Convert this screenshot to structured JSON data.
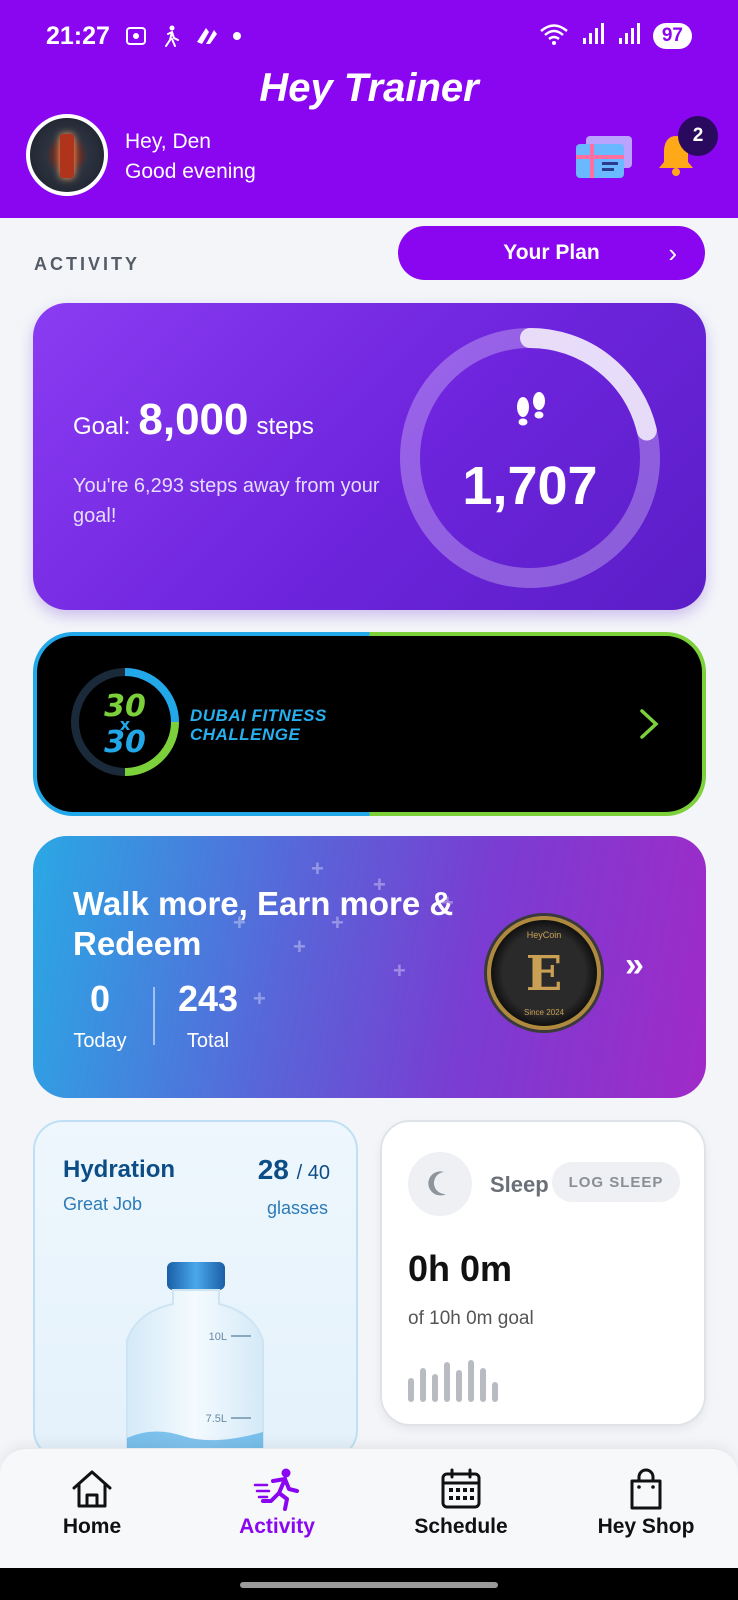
{
  "status_bar": {
    "time": "21:27",
    "battery": "97"
  },
  "header": {
    "app_title": "Hey Trainer",
    "greeting_name": "Hey, Den",
    "greeting_time": "Good evening",
    "notification_count": "2",
    "brand_color": "#8a06f0"
  },
  "activity": {
    "section_label": "ACTIVITY",
    "plan_button": "Your Plan"
  },
  "steps_card": {
    "goal_prefix": "Goal:",
    "goal_value": "8,000",
    "goal_unit": "steps",
    "remaining_text": "You're 6,293 steps away from your goal!",
    "current_steps": "1,707",
    "progress_fraction": 0.213
  },
  "challenge_card": {
    "logo_text_top": "30",
    "logo_text_mid": "x",
    "logo_text_bottom": "30",
    "line1": "DUBAI FITNESS",
    "line2": "CHALLENGE"
  },
  "rewards_card": {
    "title": "Walk more, Earn more & Redeem",
    "today_value": "0",
    "today_label": "Today",
    "total_value": "243",
    "total_label": "Total",
    "coin_top": "HeyCoin",
    "coin_letter": "E",
    "coin_bottom": "Since 2024"
  },
  "hydration_card": {
    "title": "Hydration",
    "subtitle": "Great Job",
    "count": "28",
    "goal": "/ 40",
    "unit": "glasses",
    "mark_10l": "10L",
    "mark_75l": "7.5L"
  },
  "sleep_card": {
    "title": "Sleep",
    "log_button": "LOG SLEEP",
    "duration": "0h 0m",
    "goal_text": "of 10h 0m goal"
  },
  "bottom_nav": {
    "items": [
      {
        "label": "Home",
        "icon": "home-icon"
      },
      {
        "label": "Activity",
        "icon": "running-icon"
      },
      {
        "label": "Schedule",
        "icon": "calendar-icon"
      },
      {
        "label": "Hey Shop",
        "icon": "shopping-bag-icon"
      }
    ],
    "active_index": 1
  }
}
